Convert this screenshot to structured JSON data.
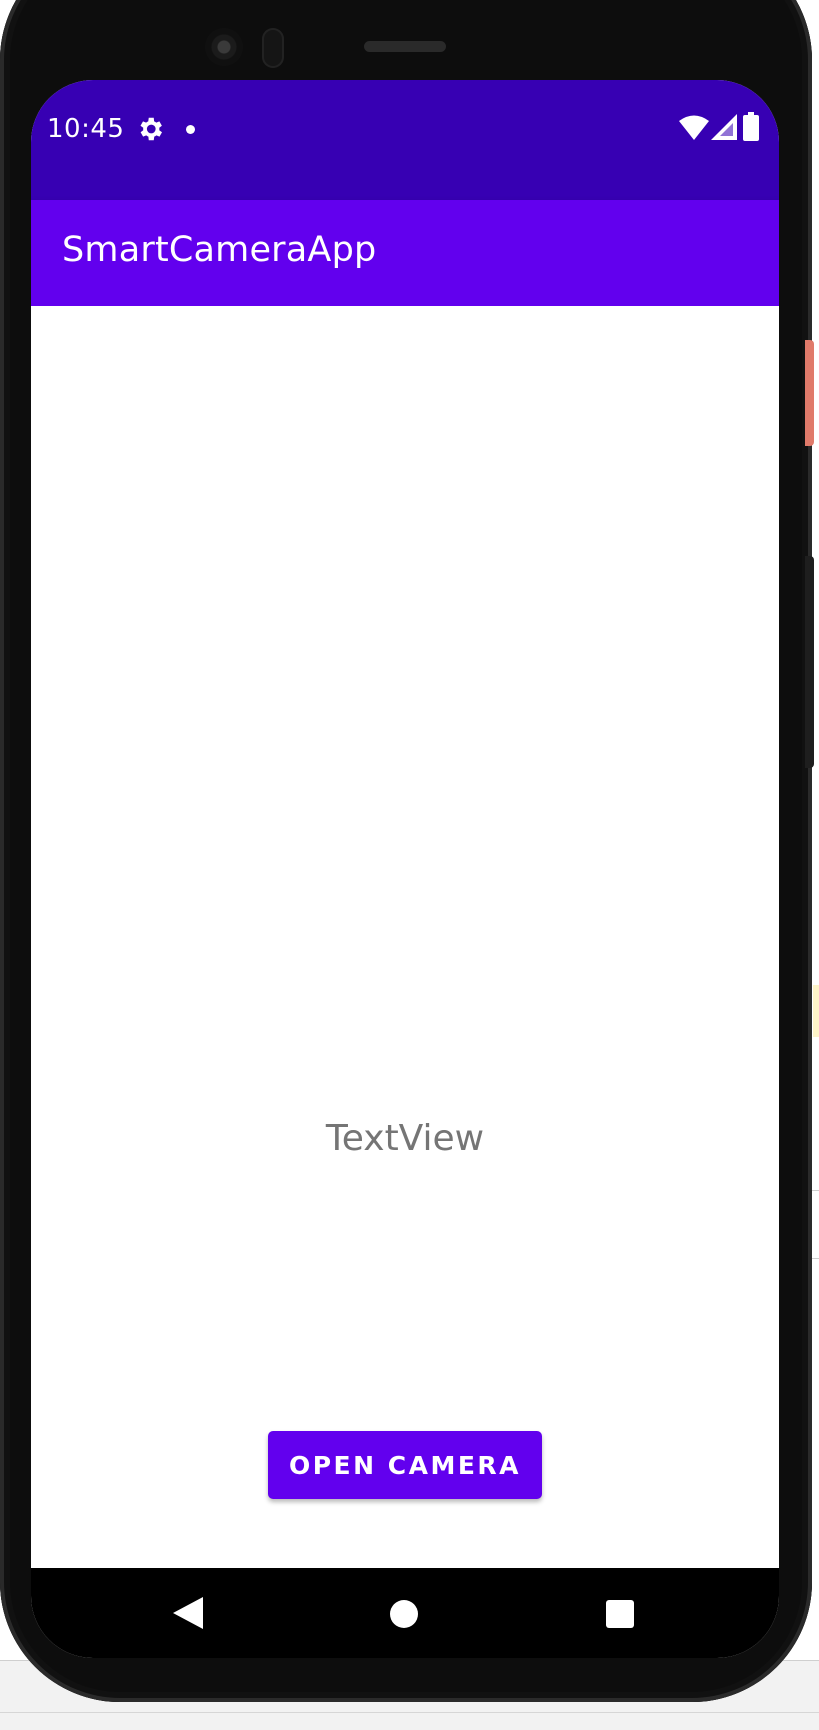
{
  "status_bar": {
    "time": "10:45",
    "icons": [
      "gear-icon",
      "notification-dot-icon",
      "wifi-icon",
      "cell-signal-icon",
      "battery-icon"
    ],
    "color": "#3700b3"
  },
  "app_bar": {
    "title": "SmartCameraApp",
    "color": "#6200ee"
  },
  "content": {
    "text_view": "TextView",
    "button_label": "OPEN CAMERA",
    "button_color": "#6200ee"
  },
  "nav_bar": {
    "icons": [
      "back-icon",
      "home-icon",
      "recent-apps-icon"
    ]
  }
}
